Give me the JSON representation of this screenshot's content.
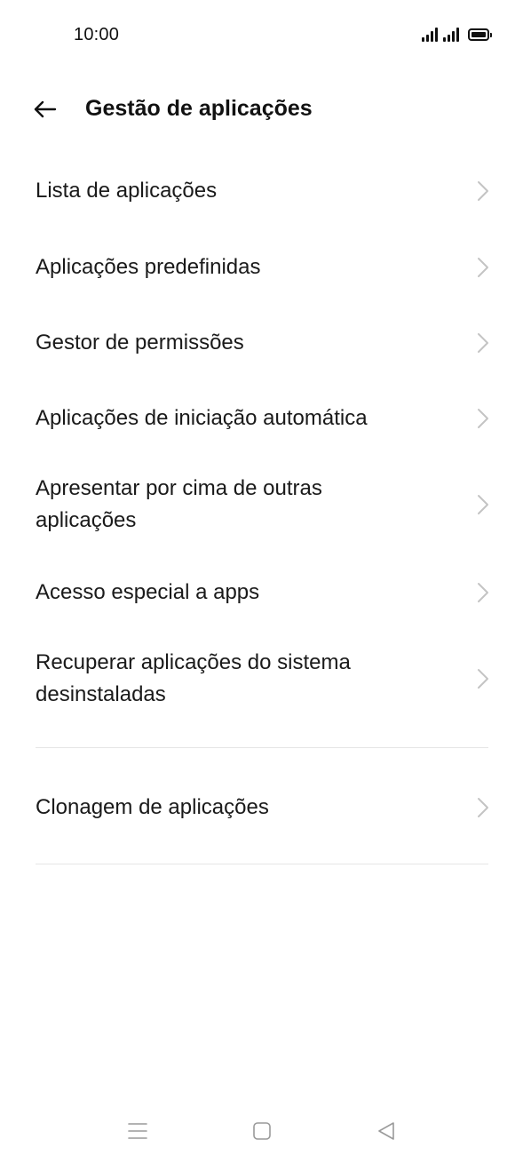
{
  "status_bar": {
    "time": "10:00",
    "icons": [
      "signal-icon",
      "signal-icon",
      "battery-icon"
    ]
  },
  "header": {
    "back_icon": "arrow-left-icon",
    "title": "Gestão de aplicações"
  },
  "menu": {
    "items": [
      {
        "label": "Lista de aplicações",
        "icon": "chevron-right-icon"
      },
      {
        "label": "Aplicações predefinidas",
        "icon": "chevron-right-icon"
      },
      {
        "label": "Gestor de permissões",
        "icon": "chevron-right-icon"
      },
      {
        "label": "Aplicações de iniciação automática",
        "icon": "chevron-right-icon"
      },
      {
        "label": "Apresentar por cima de outras aplicações",
        "icon": "chevron-right-icon"
      },
      {
        "label": "Acesso especial a apps",
        "icon": "chevron-right-icon"
      },
      {
        "label": "Recuperar aplicações do sistema desinstaladas",
        "icon": "chevron-right-icon"
      }
    ],
    "section2": [
      {
        "label": "Clonagem de aplicações",
        "icon": "chevron-right-icon"
      }
    ]
  },
  "nav_bar": {
    "icons": [
      "menu-icon",
      "home-icon",
      "back-triangle-icon"
    ]
  },
  "colors": {
    "background": "#ffffff",
    "text": "#1a1a1a",
    "chevron": "#c4c4c4",
    "divider": "#e6e6e6",
    "nav_icon": "#9a9a9a"
  }
}
